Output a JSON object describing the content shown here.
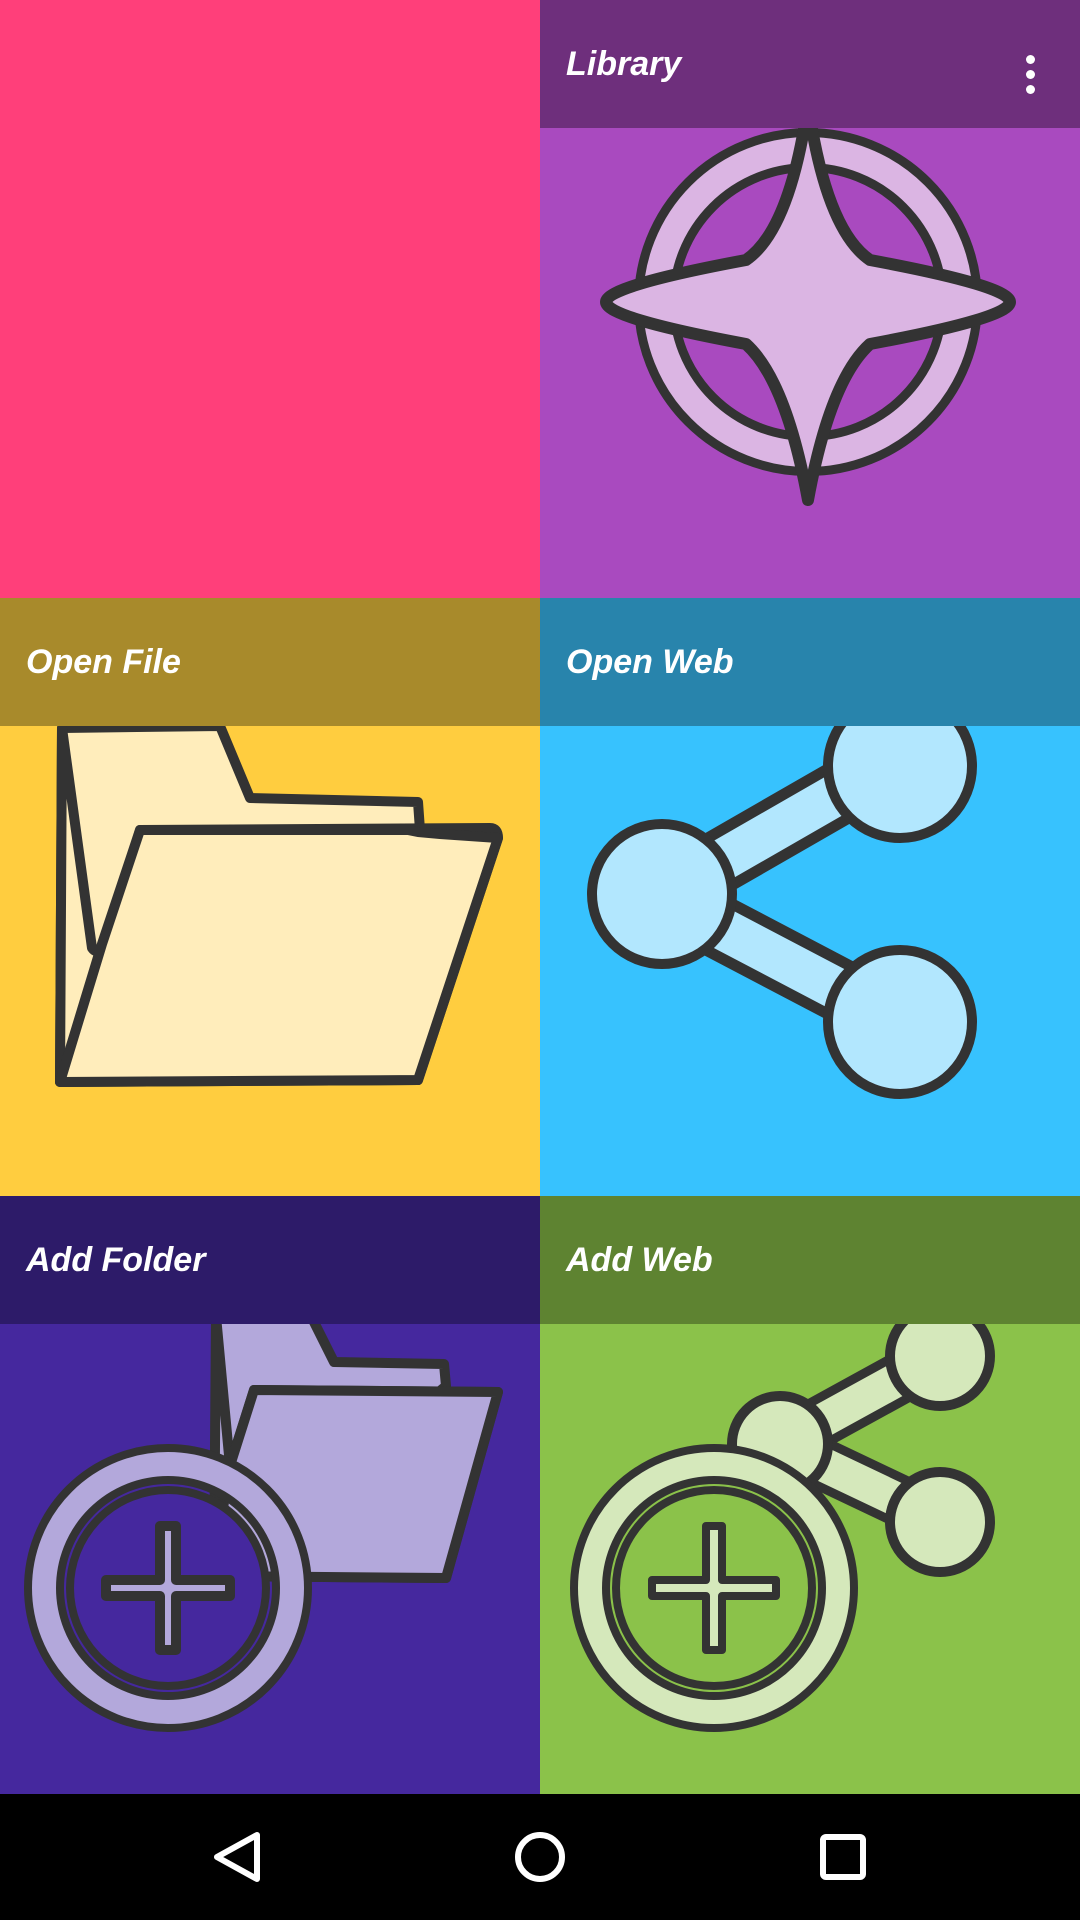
{
  "colors": {
    "tile_pink": "#FF3F7A",
    "library_bg": "#A94ABF",
    "library_header": "#6E2F7C",
    "library_light": "#DBB5E3",
    "open_file_bg": "#FFCD3F",
    "open_file_header": "#A88A2B",
    "open_file_light": "#FFEDBB",
    "open_web_bg": "#37C2FE",
    "open_web_header": "#2884AC",
    "open_web_light": "#B2E7FE",
    "add_folder_bg": "#45289E",
    "add_folder_header": "#2D1B69",
    "add_folder_light": "#B3A8DB",
    "add_web_bg": "#8BC24A",
    "add_web_header": "#5E8331",
    "add_web_light": "#D5E8BB",
    "outline": "#333333"
  },
  "tiles": {
    "library": {
      "label": "Library",
      "icon": "compass-star-icon"
    },
    "open_file": {
      "label": "Open File",
      "icon": "open-folder-icon"
    },
    "open_web": {
      "label": "Open Web",
      "icon": "share-icon"
    },
    "add_folder": {
      "label": "Add Folder",
      "icon": "folder-add-icon"
    },
    "add_web": {
      "label": "Add Web",
      "icon": "share-add-icon"
    }
  },
  "app_bar": {
    "menu_icon": "more-vert-icon"
  },
  "nav": {
    "back_icon": "back-triangle-icon",
    "home_icon": "home-circle-icon",
    "recents_icon": "recents-square-icon"
  }
}
